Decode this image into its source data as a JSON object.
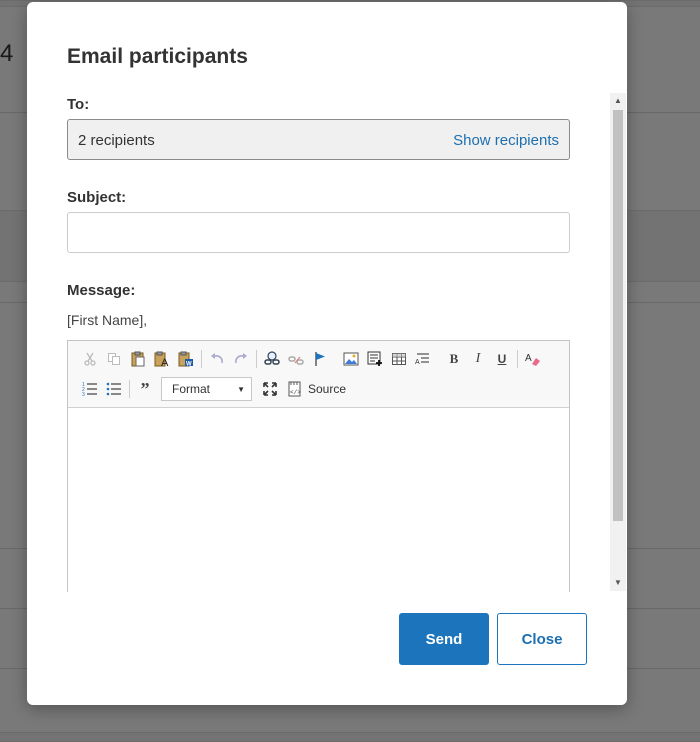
{
  "background": {
    "partial_number": "4"
  },
  "modal": {
    "title": "Email participants",
    "to_label": "To:",
    "recipients_count": "2 recipients",
    "show_recipients": "Show recipients",
    "subject_label": "Subject:",
    "subject_value": "",
    "message_label": "Message:",
    "greeting": "[First Name],",
    "editor": {
      "format_label": "Format",
      "source_label": "Source",
      "bold": "B",
      "italic": "I",
      "underline": "U",
      "blockquote": "99",
      "body": ""
    },
    "send_label": "Send",
    "close_label": "Close"
  },
  "colors": {
    "accent": "#1c75bc",
    "link": "#1e6fb0"
  }
}
